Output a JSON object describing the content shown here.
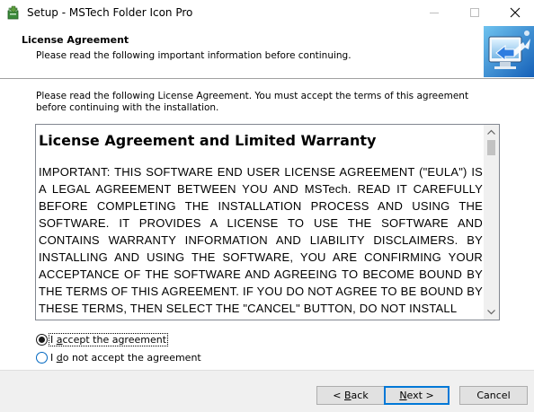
{
  "window": {
    "title": "Setup - MSTech Folder Icon Pro",
    "app_icon": "installer-icon",
    "controls": [
      "minimize-icon",
      "maximize-icon",
      "close-icon"
    ]
  },
  "header": {
    "title": "License Agreement",
    "subtitle": "Please read the following important information before continuing.",
    "image": "wizard-logo-icon"
  },
  "intro": "Please read the following License Agreement. You must accept the terms of this agreement before continuing with the installation.",
  "license": {
    "heading": "License Agreement and Limited Warranty",
    "body": "IMPORTANT: THIS SOFTWARE END USER LICENSE AGREEMENT (\"EULA\") IS A LEGAL AGREEMENT BETWEEN YOU AND MSTech. READ IT CAREFULLY BEFORE COMPLETING THE INSTALLATION PROCESS AND USING THE SOFTWARE. IT PROVIDES A LICENSE TO USE THE SOFTWARE AND CONTAINS WARRANTY INFORMATION AND LIABILITY DISCLAIMERS. BY INSTALLING AND USING THE SOFTWARE, YOU ARE CONFIRMING YOUR ACCEPTANCE OF THE SOFTWARE AND AGREEING TO BECOME BOUND BY THE TERMS OF THIS AGREEMENT. IF YOU DO NOT AGREE TO BE BOUND BY THESE TERMS, THEN SELECT THE \"CANCEL\" BUTTON, DO NOT INSTALL"
  },
  "options": {
    "accept_prefix": "I ",
    "accept_key": "a",
    "accept_rest": "ccept the agreement",
    "accept_selected": true,
    "decline_prefix": "I ",
    "decline_key": "d",
    "decline_rest": "o not accept the agreement",
    "decline_selected": false
  },
  "buttons": {
    "back_prefix": "< ",
    "back_key": "B",
    "back_rest": "ack",
    "next_key": "N",
    "next_rest": "ext >",
    "cancel": "Cancel"
  },
  "colors": {
    "focus": "#0078d7",
    "panel": "#f0f0f0"
  }
}
